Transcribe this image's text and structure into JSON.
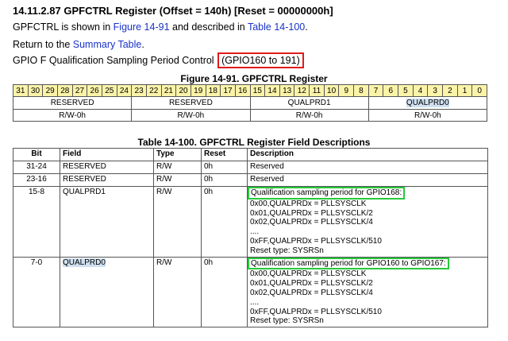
{
  "heading": "14.11.2.87 GPFCTRL Register (Offset = 140h) [Reset = 00000000h]",
  "intro": {
    "prefix": "GPFCTRL is shown in ",
    "figure_link": "Figure 14-91",
    "middle": " and described in ",
    "table_link": "Table 14-100",
    "suffix": "."
  },
  "return_line": {
    "prefix": "Return to the ",
    "link": "Summary Table",
    "suffix": "."
  },
  "qual_line": {
    "text": "GPIO F Qualification Sampling Period Control ",
    "boxed": "(GPIO160 to 191)"
  },
  "figure_title": "Figure 14-91. GPFCTRL Register",
  "register": {
    "bits": [
      "31",
      "30",
      "29",
      "28",
      "27",
      "26",
      "25",
      "24",
      "23",
      "22",
      "21",
      "20",
      "19",
      "18",
      "17",
      "16",
      "15",
      "14",
      "13",
      "12",
      "11",
      "10",
      "9",
      "8",
      "7",
      "6",
      "5",
      "4",
      "3",
      "2",
      "1",
      "0"
    ],
    "fields": [
      {
        "name": "RESERVED",
        "access": "R/W-0h",
        "highlight": false
      },
      {
        "name": "RESERVED",
        "access": "R/W-0h",
        "highlight": false
      },
      {
        "name": "QUALPRD1",
        "access": "R/W-0h",
        "highlight": false
      },
      {
        "name": "QUALPRD0",
        "access": "R/W-0h",
        "highlight": true
      }
    ]
  },
  "table_title": "Table 14-100. GPFCTRL Register Field Descriptions",
  "table": {
    "headers": [
      "Bit",
      "Field",
      "Type",
      "Reset",
      "Description"
    ],
    "rows": [
      {
        "bit": "31-24",
        "field": "RESERVED",
        "type": "R/W",
        "reset": "0h",
        "desc_title": "Reserved",
        "desc_lines": []
      },
      {
        "bit": "23-16",
        "field": "RESERVED",
        "type": "R/W",
        "reset": "0h",
        "desc_title": "Reserved",
        "desc_lines": []
      },
      {
        "bit": "15-8",
        "field": "QUALPRD1",
        "type": "R/W",
        "reset": "0h",
        "desc_title": "Qualification sampling period for GPIO168:",
        "desc_lines": [
          "0x00,QUALPRDx = PLLSYSCLK",
          "0x01,QUALPRDx = PLLSYSCLK/2",
          "0x02,QUALPRDx = PLLSYSCLK/4",
          "....",
          "0xFF,QUALPRDx = PLLSYSCLK/510",
          "Reset type: SYSRSn"
        ]
      },
      {
        "bit": "7-0",
        "field": "QUALPRD0",
        "type": "R/W",
        "reset": "0h",
        "desc_title": "Qualification sampling period for GPIO160 to GPIO167:",
        "desc_lines": [
          "0x00,QUALPRDx = PLLSYSCLK",
          "0x01,QUALPRDx = PLLSYSCLK/2",
          "0x02,QUALPRDx = PLLSYSCLK/4",
          "....",
          "0xFF,QUALPRDx = PLLSYSCLK/510",
          "Reset type: SYSRSn"
        ]
      }
    ]
  },
  "colors": {
    "link": "#1a33c8",
    "red_box": "#e01b1b",
    "green_box": "#27c93b",
    "bit_header_bg": "#fbf3a8",
    "highlight": "#cfe0f0"
  }
}
